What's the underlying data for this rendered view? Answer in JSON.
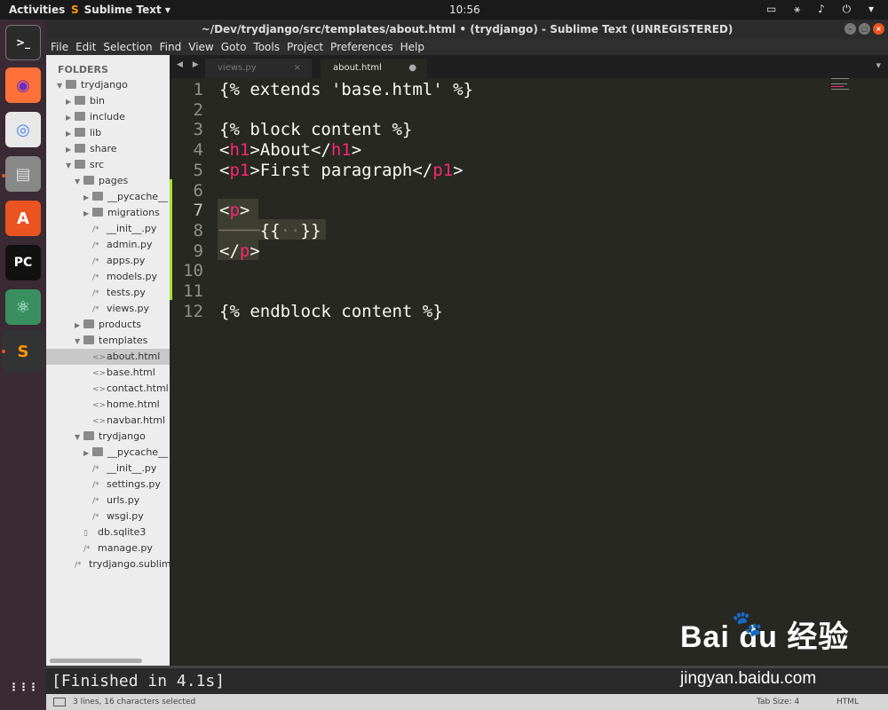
{
  "topbar": {
    "activities": "Activities",
    "app_name": "Sublime Text ▾",
    "clock": "10:56",
    "tray": "▭ ⚹ ♪ ⏻ ▾"
  },
  "dock": [
    {
      "name": "terminal-icon",
      "glyph": ">_",
      "bg": "#2b2b2b",
      "fg": "#fff"
    },
    {
      "name": "firefox-icon",
      "glyph": "◉",
      "bg": "#ff7139",
      "fg": "#6a2cc9"
    },
    {
      "name": "chrome-icon",
      "glyph": "◎",
      "bg": "#e8e8e8",
      "fg": "#4285f4"
    },
    {
      "name": "files-icon",
      "glyph": "▤",
      "bg": "#888",
      "fg": "#ddd"
    },
    {
      "name": "software-center-icon",
      "glyph": "A",
      "bg": "#e95420",
      "fg": "#fff"
    },
    {
      "name": "pycharm-icon",
      "glyph": "PC",
      "bg": "#111",
      "fg": "#fff"
    },
    {
      "name": "atom-icon",
      "glyph": "⚛",
      "bg": "#3a8f61",
      "fg": "#cfe"
    },
    {
      "name": "sublime-icon",
      "glyph": "S",
      "bg": "#333",
      "fg": "#ff9800"
    },
    {
      "name": "show-apps-icon",
      "glyph": "⋮⋮⋮",
      "bg": "transparent",
      "fg": "#fff"
    }
  ],
  "window": {
    "title": "~/Dev/trydjango/src/templates/about.html • (trydjango) - Sublime Text (UNREGISTERED)"
  },
  "menu": [
    "File",
    "Edit",
    "Selection",
    "Find",
    "View",
    "Goto",
    "Tools",
    "Project",
    "Preferences",
    "Help"
  ],
  "sidebar": {
    "heading": "FOLDERS",
    "items": [
      {
        "label": "trydjango",
        "kind": "folder",
        "open": true,
        "depth": 0
      },
      {
        "label": "bin",
        "kind": "folder",
        "open": false,
        "depth": 1
      },
      {
        "label": "include",
        "kind": "folder",
        "open": false,
        "depth": 1
      },
      {
        "label": "lib",
        "kind": "folder",
        "open": false,
        "depth": 1
      },
      {
        "label": "share",
        "kind": "folder",
        "open": false,
        "depth": 1
      },
      {
        "label": "src",
        "kind": "folder",
        "open": true,
        "depth": 1
      },
      {
        "label": "pages",
        "kind": "folder",
        "open": true,
        "depth": 2
      },
      {
        "label": "__pycache__",
        "kind": "folder",
        "open": false,
        "depth": 3
      },
      {
        "label": "migrations",
        "kind": "folder",
        "open": false,
        "depth": 3
      },
      {
        "label": "__init__.py",
        "kind": "py",
        "depth": 3
      },
      {
        "label": "admin.py",
        "kind": "py",
        "depth": 3
      },
      {
        "label": "apps.py",
        "kind": "py",
        "depth": 3
      },
      {
        "label": "models.py",
        "kind": "py",
        "depth": 3
      },
      {
        "label": "tests.py",
        "kind": "py",
        "depth": 3
      },
      {
        "label": "views.py",
        "kind": "py",
        "depth": 3
      },
      {
        "label": "products",
        "kind": "folder",
        "open": false,
        "depth": 2
      },
      {
        "label": "templates",
        "kind": "folder",
        "open": true,
        "depth": 2
      },
      {
        "label": "about.html",
        "kind": "html",
        "depth": 3,
        "selected": true
      },
      {
        "label": "base.html",
        "kind": "html",
        "depth": 3
      },
      {
        "label": "contact.html",
        "kind": "html",
        "depth": 3
      },
      {
        "label": "home.html",
        "kind": "html",
        "depth": 3
      },
      {
        "label": "navbar.html",
        "kind": "html",
        "depth": 3
      },
      {
        "label": "trydjango",
        "kind": "folder",
        "open": true,
        "depth": 2
      },
      {
        "label": "__pycache__",
        "kind": "folder",
        "open": false,
        "depth": 3
      },
      {
        "label": "__init__.py",
        "kind": "py",
        "depth": 3
      },
      {
        "label": "settings.py",
        "kind": "py",
        "depth": 3
      },
      {
        "label": "urls.py",
        "kind": "py",
        "depth": 3
      },
      {
        "label": "wsgi.py",
        "kind": "py",
        "depth": 3
      },
      {
        "label": "db.sqlite3",
        "kind": "file",
        "depth": 2
      },
      {
        "label": "manage.py",
        "kind": "py",
        "depth": 2
      },
      {
        "label": "trydjango.sublime-project",
        "kind": "py",
        "depth": 1
      }
    ]
  },
  "tabs": {
    "inactive": {
      "label": "views.py",
      "close": "×"
    },
    "active": {
      "label": "about.html",
      "modified": "●"
    },
    "nav": "◀ ▶",
    "more": "▾"
  },
  "editor": {
    "lines": [
      {
        "n": "1",
        "html": "{% extends 'base.html' %}"
      },
      {
        "n": "2",
        "html": ""
      },
      {
        "n": "3",
        "html": "{% block content %}"
      },
      {
        "n": "4",
        "html": "&lt;<span class='tag'>h1</span>&gt;About&lt;/<span class='tag'>h1</span>&gt;"
      },
      {
        "n": "5",
        "html": "&lt;<span class='tag'>p1</span>&gt;First paragraph&lt;/<span class='tag'>p1</span>&gt;"
      },
      {
        "n": "6",
        "html": ""
      },
      {
        "n": "7",
        "html": "&lt;<span class='tag'>p</span>&gt;"
      },
      {
        "n": "8",
        "html": "<span style='color:#75715e'>────</span>{{<span style='color:#75715e'>··</span>}}"
      },
      {
        "n": "9",
        "html": "&lt;/<span class='tag'>p</span>&gt;"
      },
      {
        "n": "10",
        "html": ""
      },
      {
        "n": "11",
        "html": ""
      },
      {
        "n": "12",
        "html": "{% endblock content %}"
      }
    ]
  },
  "output": {
    "text": "[Finished in 4.1s]"
  },
  "status": {
    "selection": "3 lines, 16 characters selected",
    "tab_size": "Tab Size: 4",
    "syntax": "HTML"
  },
  "watermark": {
    "brand": "Bai  du 经验",
    "url": "jingyan.baidu.com"
  }
}
